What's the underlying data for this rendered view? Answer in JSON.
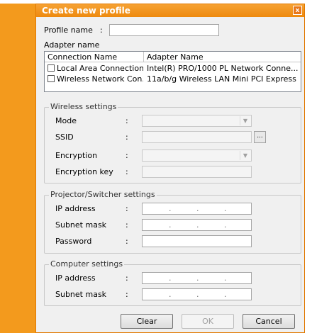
{
  "window": {
    "title": "Create new profile",
    "close_glyph": "x"
  },
  "profile": {
    "label": "Profile name",
    "colon": ":",
    "value": ""
  },
  "adapter": {
    "label": "Adapter name",
    "columns": [
      "Connection Name",
      "Adapter Name"
    ],
    "rows": [
      {
        "connection": "Local Area Connection",
        "adapter": "Intel(R) PRO/1000 PL Network Conne...",
        "checked": false
      },
      {
        "connection": "Wireless Network Con...",
        "adapter": "11a/b/g Wireless LAN Mini PCI Express ...",
        "checked": false
      }
    ]
  },
  "wireless": {
    "title": "Wireless settings",
    "mode_label": "Mode",
    "ssid_label": "SSID",
    "browse_label": "...",
    "encryption_label": "Encryption",
    "key_label": "Encryption key",
    "colon": ":"
  },
  "projector": {
    "title": "Projector/Switcher settings",
    "ip_label": "IP address",
    "mask_label": "Subnet mask",
    "password_label": "Password",
    "colon": ":",
    "dot": "."
  },
  "computer": {
    "title": "Computer settings",
    "ip_label": "IP address",
    "mask_label": "Subnet mask",
    "colon": ":",
    "dot": "."
  },
  "buttons": {
    "clear": "Clear",
    "ok": "OK",
    "cancel": "Cancel"
  },
  "colors": {
    "accent": "#f39a1d",
    "title_bar": "#ee8a0e"
  },
  "icons": {
    "combo": "chevron-down-icon",
    "close": "close-icon"
  }
}
